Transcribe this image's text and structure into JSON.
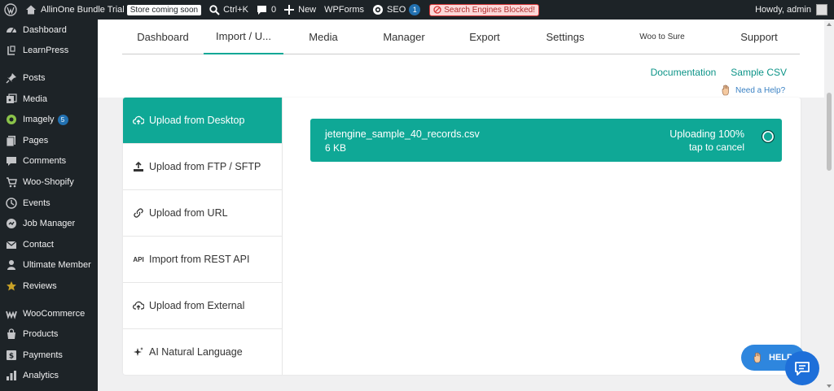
{
  "adminbar": {
    "site_name": "AllinOne Bundle Trial",
    "store_badge": "Store coming soon",
    "shortcut": "Ctrl+K",
    "comments_count": "0",
    "new_label": "New",
    "wpforms_label": "WPForms",
    "seo_label": "SEO",
    "seo_count": "1",
    "blocked_label": "Search Engines Blocked!",
    "howdy": "Howdy, admin"
  },
  "sidebar": {
    "items": [
      {
        "label": "Dashboard",
        "icon": "dashboard-icon"
      },
      {
        "label": "LearnPress",
        "icon": "learnpress-icon"
      },
      {
        "label": "Posts",
        "icon": "pin-icon"
      },
      {
        "label": "Media",
        "icon": "media-icon"
      },
      {
        "label": "Imagely",
        "icon": "imagely-icon",
        "badge": "5"
      },
      {
        "label": "Pages",
        "icon": "pages-icon"
      },
      {
        "label": "Comments",
        "icon": "comment-icon"
      },
      {
        "label": "Woo-Shopify",
        "icon": "cart-icon"
      },
      {
        "label": "Events",
        "icon": "events-icon"
      },
      {
        "label": "Job Manager",
        "icon": "job-icon"
      },
      {
        "label": "Contact",
        "icon": "mail-icon"
      },
      {
        "label": "Ultimate Member",
        "icon": "user-icon"
      },
      {
        "label": "Reviews",
        "icon": "star-icon"
      },
      {
        "label": "WooCommerce",
        "icon": "woo-icon"
      },
      {
        "label": "Products",
        "icon": "products-icon"
      },
      {
        "label": "Payments",
        "icon": "payments-icon"
      },
      {
        "label": "Analytics",
        "icon": "analytics-icon"
      }
    ]
  },
  "tabs": [
    {
      "label": "Dashboard"
    },
    {
      "label": "Import / U..."
    },
    {
      "label": "Media"
    },
    {
      "label": "Manager"
    },
    {
      "label": "Export"
    },
    {
      "label": "Settings"
    },
    {
      "label": "Woo to Sure"
    },
    {
      "label": "Support"
    }
  ],
  "active_tab": "Import / U...",
  "links": {
    "documentation": "Documentation",
    "sample_csv": "Sample CSV",
    "need_help": "Need a Help?"
  },
  "methods": [
    {
      "label": "Upload from Desktop",
      "icon": "cloud-upload-icon"
    },
    {
      "label": "Upload from FTP / SFTP",
      "icon": "upload-icon"
    },
    {
      "label": "Upload from URL",
      "icon": "link-icon"
    },
    {
      "label": "Import from REST API",
      "icon": "api-icon"
    },
    {
      "label": "Upload from External",
      "icon": "cloud-icon"
    },
    {
      "label": "AI Natural Language",
      "icon": "sparkle-icon"
    }
  ],
  "upload": {
    "file_name": "jetengine_sample_40_records.csv",
    "file_size": "6 KB",
    "status": "Uploading 100%",
    "cancel": "tap to cancel",
    "progress": 1.0
  },
  "help_button": "HELP",
  "api_glyph": "API",
  "colors": {
    "accent": "#0fa896",
    "admin_bg": "#1d2327",
    "link": "#0d9488",
    "help_blue": "#2e86de"
  }
}
